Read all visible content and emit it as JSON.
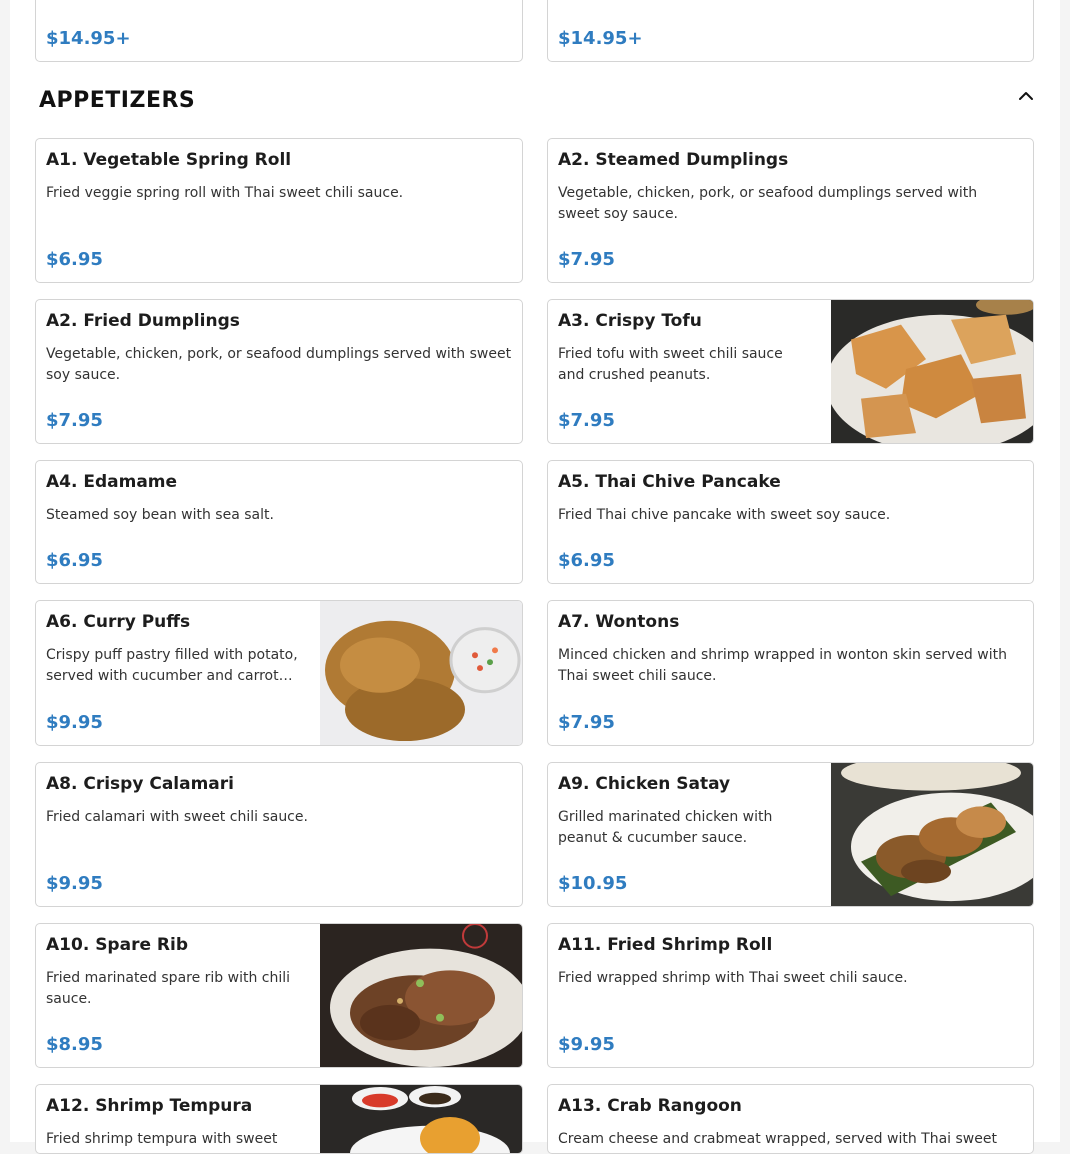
{
  "top_prices": [
    "$14.95+",
    "$14.95+"
  ],
  "section": {
    "title": "APPETIZERS"
  },
  "items": [
    {
      "name": "A1. Vegetable Spring Roll",
      "desc": "Fried veggie spring roll with Thai sweet chili sauce.",
      "price": "$6.95"
    },
    {
      "name": "A2. Steamed Dumplings",
      "desc": "Vegetable, chicken, pork, or seafood dumplings served with sweet soy sauce.",
      "price": "$7.95"
    },
    {
      "name": "A2. Fried Dumplings",
      "desc": "Vegetable, chicken, pork, or seafood dumplings served with sweet soy sauce.",
      "price": "$7.95"
    },
    {
      "name": "A3. Crispy Tofu",
      "desc": "Fried tofu with sweet chili sauce and crushed peanuts.",
      "price": "$7.95",
      "photo": "crispy-tofu-photo"
    },
    {
      "name": "A4. Edamame",
      "desc": "Steamed soy bean with sea salt.",
      "price": "$6.95"
    },
    {
      "name": "A5. Thai Chive Pancake",
      "desc": "Fried Thai chive pancake with sweet soy sauce.",
      "price": "$6.95"
    },
    {
      "name": "A6. Curry Puffs",
      "desc": "Crispy puff pastry filled with potato, served with cucumber and carrot…",
      "price": "$9.95",
      "photo": "curry-puffs-photo"
    },
    {
      "name": "A7. Wontons",
      "desc": "Minced chicken and shrimp wrapped in wonton skin served with Thai sweet chili sauce.",
      "price": "$7.95"
    },
    {
      "name": "A8. Crispy Calamari",
      "desc": "Fried calamari with sweet chili sauce.",
      "price": "$9.95"
    },
    {
      "name": "A9. Chicken Satay",
      "desc": "Grilled marinated chicken with peanut & cucumber sauce.",
      "price": "$10.95",
      "photo": "chicken-satay-photo"
    },
    {
      "name": "A10. Spare Rib",
      "desc": "Fried marinated spare rib with chili sauce.",
      "price": "$8.95",
      "photo": "spare-rib-photo"
    },
    {
      "name": "A11. Fried Shrimp Roll",
      "desc": "Fried wrapped shrimp with Thai sweet chili sauce.",
      "price": "$9.95"
    },
    {
      "name": "A12. Shrimp Tempura",
      "desc": "Fried shrimp tempura with sweet",
      "price": "",
      "photo": "shrimp-tempura-photo"
    },
    {
      "name": "A13. Crab Rangoon",
      "desc": "Cream cheese and crabmeat wrapped, served with Thai sweet",
      "price": ""
    }
  ],
  "icons": {
    "collapse": "chevron-up-icon"
  },
  "colors": {
    "price": "#2f7cc0",
    "border": "#d4d4d4"
  }
}
